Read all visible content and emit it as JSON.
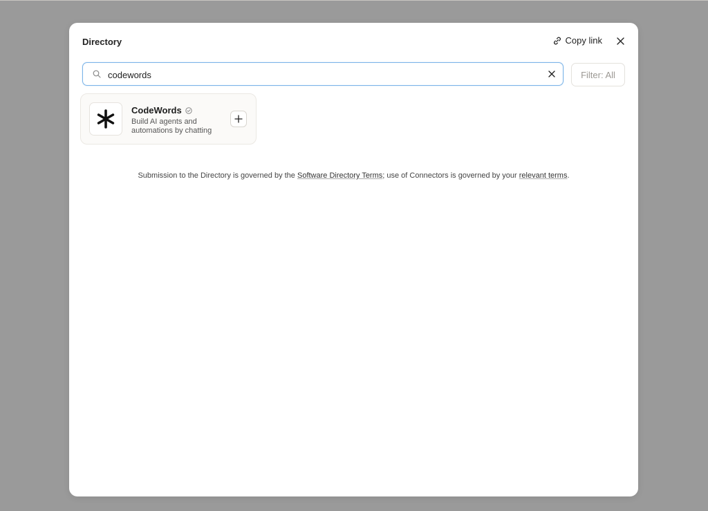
{
  "modal": {
    "title": "Directory",
    "copy_link_label": "Copy link"
  },
  "search": {
    "value": "codewords"
  },
  "filter": {
    "label": "Filter: All"
  },
  "results": [
    {
      "name": "CodeWords",
      "description": "Build AI agents and automations by chatting",
      "verified": true,
      "icon": "asterisk-logo-icon"
    }
  ],
  "footer": {
    "prefix": "Submission to the Directory is governed by the ",
    "link1": "Software Directory Terms",
    "middle": "; use of Connectors is governed by your ",
    "link2": "relevant terms",
    "suffix": "."
  },
  "colors": {
    "backdrop": "#9a9a9a",
    "focus_border": "#7cb4e8"
  }
}
